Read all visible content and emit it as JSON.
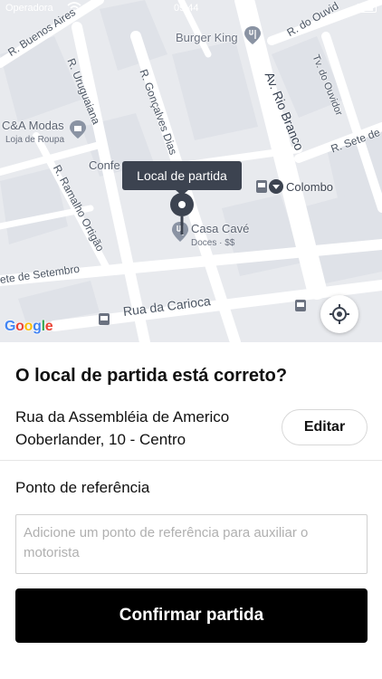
{
  "status_bar": {
    "carrier": "Operadora",
    "time": "09:44"
  },
  "map": {
    "streets": [
      "R. Buenos Aires",
      "R. Uruguaiana",
      "R. Gonçalves Dias",
      "Av. Rio Branco",
      "R. do Ouvid",
      "Tv. do Ouvidor",
      "R. Sete de",
      "R. Ramalho Ortigão",
      "ete de Setembro",
      "Rua da Carioca"
    ],
    "pois": {
      "burger_king": "Burger King",
      "ca_modas": "C&A Modas",
      "ca_modas_sub": "Loja de Roupa",
      "confeitaria": "Confe",
      "colombo": "Colombo",
      "casa_cave": "Casa Cavé",
      "casa_cave_sub": "Doces · $$"
    },
    "pin_tooltip": "Local de partida",
    "google_logo": "Google"
  },
  "sheet": {
    "title": "O local de partida está correto?",
    "address": "Rua da Assembléia de Americo Ooberlander, 10 - Centro",
    "edit_label": "Editar",
    "reference_label": "Ponto de referência",
    "reference_value": "",
    "reference_placeholder": "Adicione um ponto de referência para auxiliar o motorista",
    "confirm_label": "Confirmar partida"
  },
  "colors": {
    "primary_button": "#000000",
    "tooltip": "#3c4350",
    "map_background": "#e8eaee"
  }
}
